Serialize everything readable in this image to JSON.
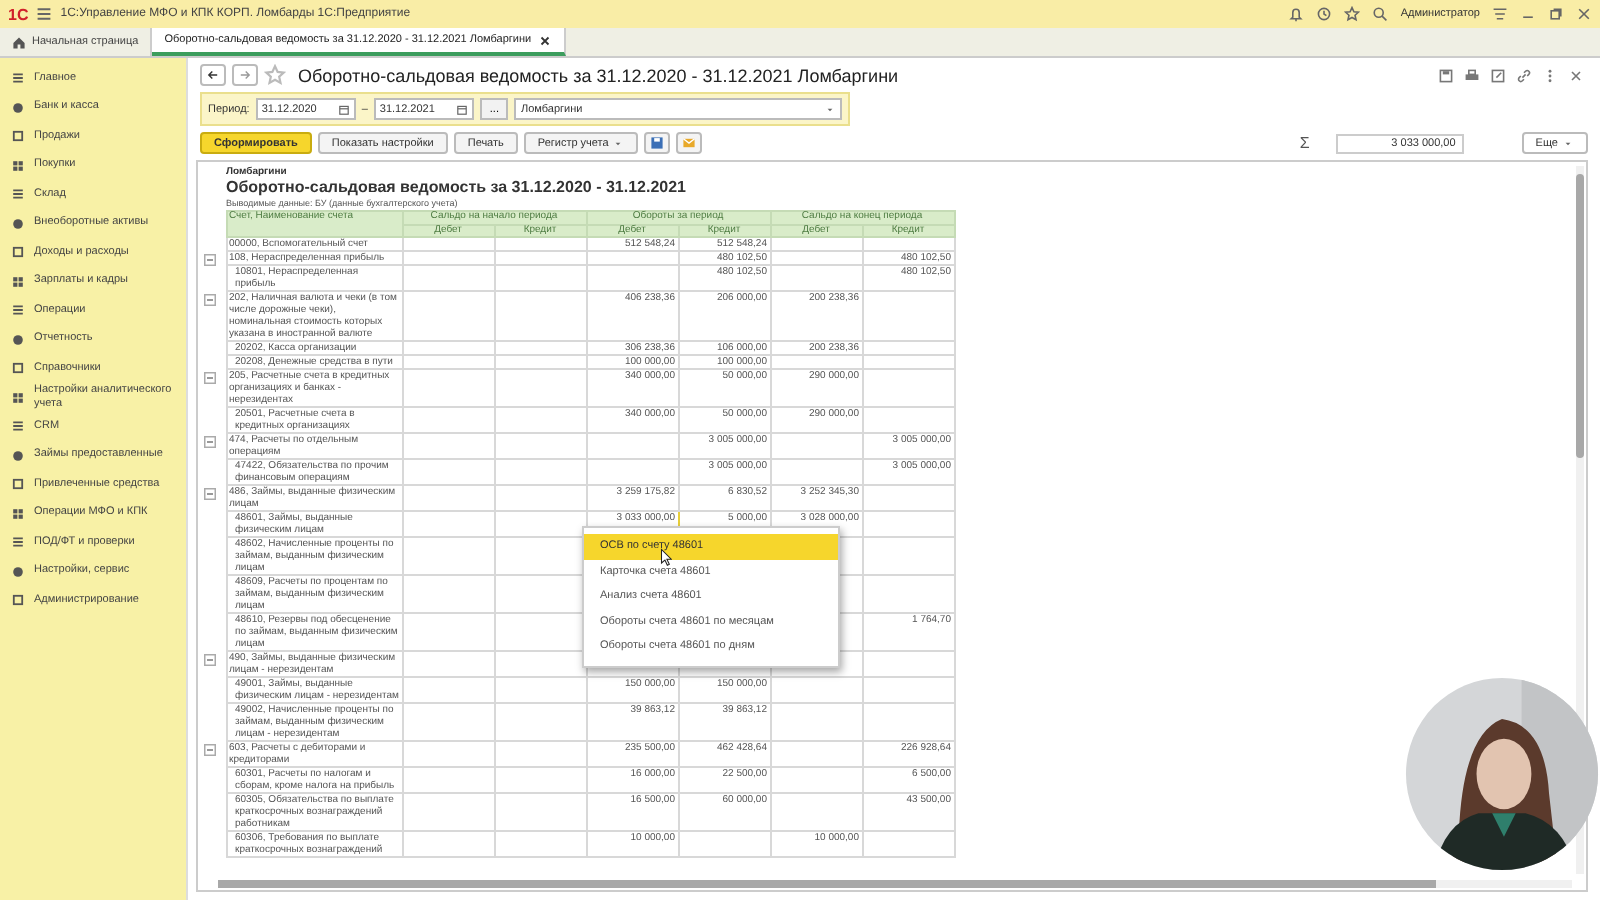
{
  "window": {
    "logo": "1С",
    "title": "1С:Управление МФО и КПК КОРП. Ломбарды 1С:Предприятие",
    "user": "Администратор"
  },
  "tabs": [
    {
      "label": "Начальная страница",
      "selected": false,
      "closable": false
    },
    {
      "label": "Оборотно-сальдовая ведомость за 31.12.2020 - 31.12.2021 Ломбаргини",
      "selected": true,
      "closable": true
    }
  ],
  "sidebar": {
    "items": [
      "Главное",
      "Банк и касса",
      "Продажи",
      "Покупки",
      "Склад",
      "Внеоборотные активы",
      "Доходы и расходы",
      "Зарплаты и кадры",
      "Операции",
      "Отчетность",
      "Справочники",
      "Настройки аналитического учета",
      "CRM",
      "Займы предоставленные",
      "Привлеченные средства",
      "Операции МФО и КПК",
      "ПОД/ФТ и проверки",
      "Настройки, сервис",
      "Администрирование"
    ]
  },
  "form": {
    "title": "Оборотно-сальдовая ведомость за 31.12.2020 - 31.12.2021 Ломбаргини",
    "period": {
      "label": "Период:",
      "from": "31.12.2020",
      "dash": "–",
      "to": "31.12.2021",
      "choose": "...",
      "organization": "Ломбаргини"
    },
    "buttons": [
      {
        "label": "Сформировать",
        "kind": "primary"
      },
      {
        "label": "Показать настройки",
        "kind": "plain"
      },
      {
        "label": "Печать",
        "kind": "plain"
      },
      {
        "label": "Регистр учета",
        "kind": "dropdown"
      },
      {
        "kind": "save"
      },
      {
        "kind": "mail"
      }
    ],
    "sum_sign": "Σ",
    "sum": "3 033 000,00",
    "more": "Еще"
  },
  "report": {
    "organization": "Ломбаргини",
    "title": "Оборотно-сальдовая ведомость за 31.12.2020 - 31.12.2021",
    "output": "Выводимые данные:  БУ (данные бухгалтерского учета)",
    "columns": {
      "account": "Счет, Наименование счета",
      "groups": [
        {
          "label": "Сальдо на начало периода",
          "debit": "Дебет",
          "credit": "Кредит"
        },
        {
          "label": "Обороты за период",
          "debit": "Дебет",
          "credit": "Кредит"
        },
        {
          "label": "Сальдо на конец периода",
          "debit": "Дебет",
          "credit": "Кредит"
        }
      ]
    },
    "rows": [
      {
        "kind": "account",
        "account": "00000, Вспомогательный счет",
        "turnover_debit": "512 548,24",
        "turnover_credit": "512 548,24",
        "selected": false
      },
      {
        "kind": "group",
        "account": "108, Нераспределенная прибыль",
        "turnover_credit": "480 102,50",
        "end_credit": "480 102,50",
        "selected": false
      },
      {
        "kind": "sub",
        "account": "10801, Нераспределенная прибыль",
        "turnover_credit": "480 102,50",
        "end_credit": "480 102,50",
        "selected": false
      },
      {
        "kind": "group",
        "account": "202, Наличная валюта и чеки (в том числе дорожные чеки), номинальная стоимость которых указана в иностранной валюте",
        "turnover_debit": "406 238,36",
        "turnover_credit": "206 000,00",
        "end_debit": "200 238,36",
        "selected": false
      },
      {
        "kind": "sub",
        "account": "20202, Касса организации",
        "turnover_debit": "306 238,36",
        "turnover_credit": "106 000,00",
        "end_debit": "200 238,36",
        "selected": false
      },
      {
        "kind": "sub",
        "account": "20208, Денежные средства в пути",
        "turnover_debit": "100 000,00",
        "turnover_credit": "100 000,00",
        "selected": false
      },
      {
        "kind": "group",
        "account": "205, Расчетные счета в кредитных организациях и банках - нерезидентах",
        "turnover_debit": "340 000,00",
        "turnover_credit": "50 000,00",
        "end_debit": "290 000,00",
        "selected": false
      },
      {
        "kind": "sub",
        "account": "20501, Расчетные счета в кредитных организациях",
        "turnover_debit": "340 000,00",
        "turnover_credit": "50 000,00",
        "end_debit": "290 000,00",
        "selected": false
      },
      {
        "kind": "group",
        "account": "474, Расчеты по отдельным операциям",
        "turnover_credit": "3 005 000,00",
        "end_credit": "3 005 000,00",
        "selected": false
      },
      {
        "kind": "sub",
        "account": "47422, Обязательства по прочим финансовым операциям",
        "turnover_credit": "3 005 000,00",
        "end_credit": "3 005 000,00",
        "selected": false
      },
      {
        "kind": "group",
        "account": "486, Займы, выданные физическим лицам",
        "turnover_debit": "3 259 175,82",
        "turnover_credit": "6 830,52",
        "end_debit": "3 252 345,30",
        "selected": false
      },
      {
        "kind": "sub",
        "account": "48601, Займы, выданные физическим лицам",
        "turnover_debit": "3 033 000,00",
        "turnover_credit": "5 000,00",
        "end_debit": "3 028 000,00",
        "selected": true
      },
      {
        "kind": "sub",
        "account": "48602, Начисленные проценты по займам, выданным физическим лицам"
      },
      {
        "kind": "sub",
        "account": "48609, Расчеты по процентам по займам, выданным физическим лицам"
      },
      {
        "kind": "sub",
        "account": "48610, Резервы под обесценение по займам, выданным физическим лицам",
        "end_credit": "1 764,70"
      },
      {
        "kind": "group",
        "account": "490, Займы, выданные физическим лицам - нерезидентам",
        "selected": false
      },
      {
        "kind": "sub",
        "account": "49001, Займы, выданные физическим лицам - нерезидентам",
        "turnover_debit": "150 000,00",
        "turnover_credit": "150 000,00",
        "selected": false
      },
      {
        "kind": "sub",
        "account": "49002, Начисленные проценты по займам, выданным физическим лицам - нерезидентам",
        "turnover_debit": "39 863,12",
        "turnover_credit": "39 863,12",
        "selected": false
      },
      {
        "kind": "group",
        "account": "603, Расчеты с дебиторами и кредиторами",
        "turnover_debit": "235 500,00",
        "turnover_credit": "462 428,64",
        "end_credit": "226 928,64",
        "selected": false
      },
      {
        "kind": "sub",
        "account": "60301, Расчеты по налогам и сборам, кроме налога на прибыль",
        "turnover_debit": "16 000,00",
        "turnover_credit": "22 500,00",
        "end_credit": "6 500,00",
        "selected": false
      },
      {
        "kind": "sub",
        "account": "60305, Обязательства по выплате краткосрочных вознаграждений работникам",
        "turnover_debit": "16 500,00",
        "turnover_credit": "60 000,00",
        "end_credit": "43 500,00",
        "selected": false
      },
      {
        "kind": "sub",
        "account": "60306, Требования по выплате краткосрочных вознаграждений",
        "turnover_debit": "10 000,00",
        "end_debit": "10 000,00",
        "selected": false
      }
    ]
  },
  "context_menu": [
    {
      "label": "ОСВ по счету 48601",
      "selected": true
    },
    {
      "label": "Карточка счета 48601",
      "selected": false
    },
    {
      "label": "Анализ счета 48601",
      "selected": false
    },
    {
      "label": "Обороты счета 48601 по месяцам",
      "selected": false
    },
    {
      "label": "Обороты счета 48601 по дням",
      "selected": false
    }
  ]
}
